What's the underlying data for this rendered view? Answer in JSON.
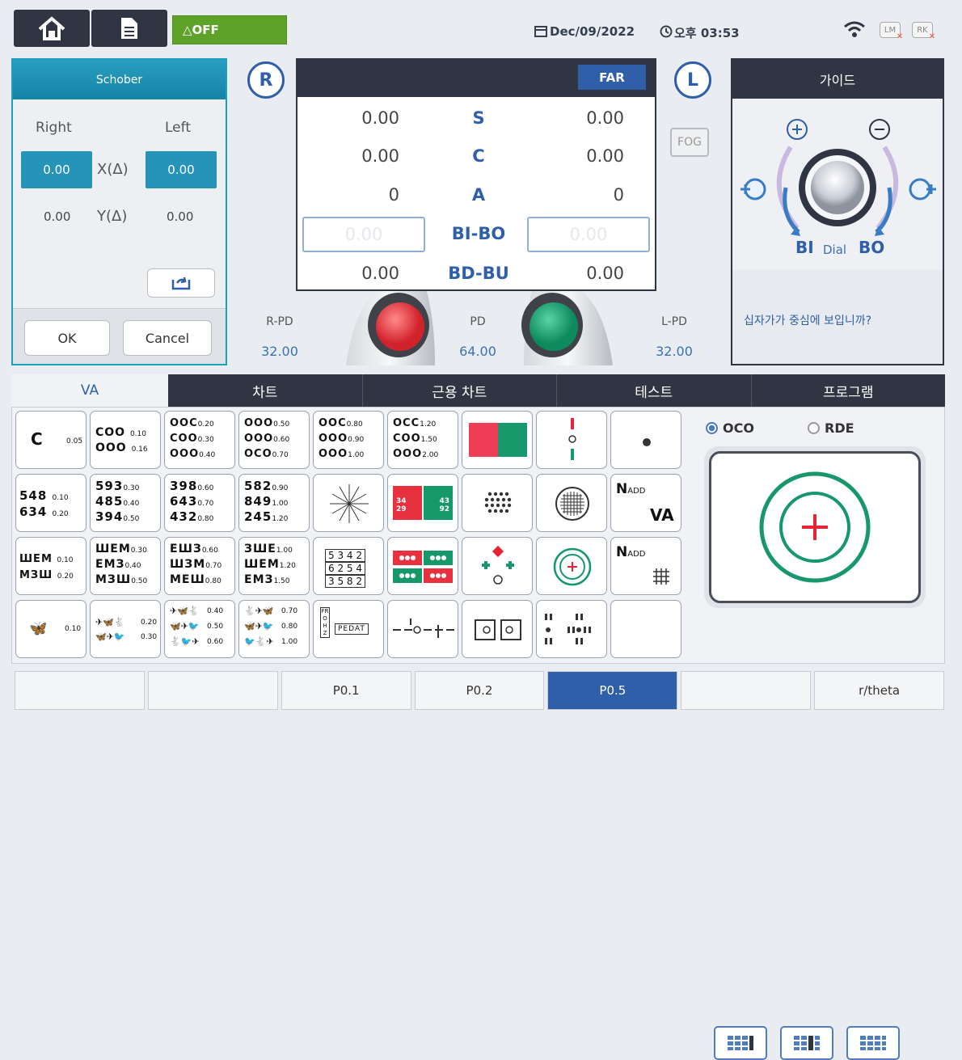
{
  "topbar": {
    "off_label": "△OFF",
    "date": "Dec/09/2022",
    "time": "오후 03:53",
    "lm_badge": "LM",
    "rk_badge": "RK"
  },
  "schober": {
    "title": "Schober",
    "right_label": "Right",
    "left_label": "Left",
    "x_label": "X(Δ)",
    "y_label": "Y(Δ)",
    "x_right": "0.00",
    "x_left": "0.00",
    "y_right": "0.00",
    "y_left": "0.00",
    "ok": "OK",
    "cancel": "Cancel"
  },
  "refraction": {
    "r_label": "R",
    "l_label": "L",
    "mode": "FAR",
    "rows": [
      {
        "name": "S",
        "right": "0.00",
        "left": "0.00"
      },
      {
        "name": "C",
        "right": "0.00",
        "left": "0.00"
      },
      {
        "name": "A",
        "right": "0",
        "left": "0"
      },
      {
        "name": "BI-BO",
        "right": "0.00",
        "left": "0.00"
      },
      {
        "name": "BD-BU",
        "right": "0.00",
        "left": "0.00"
      }
    ],
    "fog": "FOG",
    "rpd_label": "R-PD",
    "rpd_value": "32.00",
    "pd_label": "PD",
    "pd_value": "64.00",
    "lpd_label": "L-PD",
    "lpd_value": "32.00"
  },
  "guide": {
    "title": "가이드",
    "bi": "BI",
    "dial": "Dial",
    "bo": "BO",
    "question": "십자가가 중심에 보입니까?"
  },
  "tabs": [
    "VA",
    "차트",
    "근용 차트",
    "테스트",
    "프로그램"
  ],
  "charts": {
    "c1_val": "0.05",
    "c2": [
      [
        "COO",
        "0.10"
      ],
      [
        "OOO",
        "0.16"
      ]
    ],
    "c3": [
      [
        "OOC",
        "0.20"
      ],
      [
        "COO",
        "0.30"
      ],
      [
        "OOO",
        "0.40"
      ]
    ],
    "c4": [
      [
        "OOO",
        "0.50"
      ],
      [
        "OOO",
        "0.60"
      ],
      [
        "OCO",
        "0.70"
      ]
    ],
    "c5": [
      [
        "OOC",
        "0.80"
      ],
      [
        "OOO",
        "0.90"
      ],
      [
        "OOO",
        "1.00"
      ]
    ],
    "c6": [
      [
        "OCC",
        "1.20"
      ],
      [
        "COO",
        "1.50"
      ],
      [
        "OOO",
        "2.00"
      ]
    ],
    "n1": [
      [
        "548",
        "0.10"
      ],
      [
        "634",
        "0.20"
      ]
    ],
    "n2": [
      [
        "593",
        "0.30"
      ],
      [
        "485",
        "0.40"
      ],
      [
        "394",
        "0.50"
      ]
    ],
    "n3": [
      [
        "398",
        "0.60"
      ],
      [
        "643",
        "0.70"
      ],
      [
        "432",
        "0.80"
      ]
    ],
    "n4": [
      [
        "582",
        "0.90"
      ],
      [
        "849",
        "1.00"
      ],
      [
        "245",
        "1.20"
      ]
    ],
    "e1": [
      [
        "ШЕМ",
        "0.10"
      ],
      [
        "МЗШ",
        "0.20"
      ]
    ],
    "e2": [
      [
        "ШЕМ",
        "0.30"
      ],
      [
        "ЕМЗ",
        "0.40"
      ],
      [
        "МЗШ",
        "0.50"
      ]
    ],
    "e3": [
      [
        "ЕШЗ",
        "0.60"
      ],
      [
        "ШЗМ",
        "0.70"
      ],
      [
        "МЕШ",
        "0.80"
      ]
    ],
    "e4": [
      [
        "ЗШЕ",
        "1.00"
      ],
      [
        "ШЕМ",
        "1.20"
      ],
      [
        "ЕМЗ",
        "1.50"
      ]
    ],
    "b1_val": "0.10",
    "b2": [
      [
        "0.20"
      ],
      [
        "0.30"
      ]
    ],
    "b3": [
      [
        "0.40"
      ],
      [
        "0.50"
      ],
      [
        "0.60"
      ]
    ],
    "b4": [
      [
        "0.70"
      ],
      [
        "0.80"
      ],
      [
        "1.00"
      ]
    ],
    "nadd1": "N",
    "nadd1_sub": "ADD",
    "nadd1_va": "VA",
    "nadd2": "N",
    "nadd2_sub": "ADD",
    "digits_rows": [
      "5 3 4 2",
      "6 2 5 4",
      "3 5 8 2"
    ],
    "fwords": "FROHZ",
    "pedat": "PEDAT",
    "ishihara": [
      "34",
      "43",
      "29",
      "92"
    ]
  },
  "right_panel": {
    "opt1": "OCO",
    "opt2": "RDE"
  },
  "bottombar": [
    "",
    "",
    "P0.1",
    "P0.2",
    "P0.5",
    "",
    "r/theta"
  ],
  "colors": {
    "accent": "#2f5fa8",
    "teal": "#2694b9",
    "dark": "#2f3542",
    "green": "#5fa22a"
  }
}
